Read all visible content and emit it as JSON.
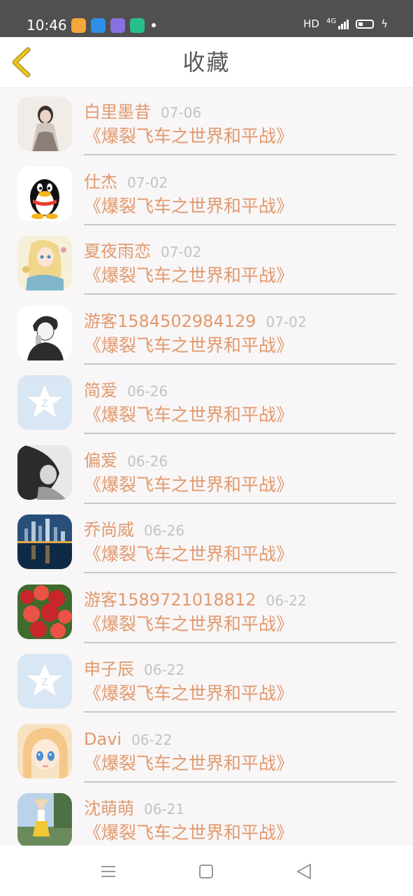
{
  "status_bar": {
    "time": "10:46",
    "network": "HD",
    "signal": "4G",
    "app_icons": [
      "calendar-app-icon",
      "browser-app-icon",
      "gallery-app-icon",
      "notes-app-icon"
    ],
    "app_colors": [
      "#f4a73a",
      "#2f8fe8",
      "#8a6fe0",
      "#27c08d"
    ]
  },
  "header": {
    "title": "收藏",
    "back_icon": "chevron-left-icon",
    "accent_color": "#f0c61e"
  },
  "favorites": [
    {
      "name": "白里墨昔",
      "date": "07-06",
      "book": "《爆裂飞车之世界和平战》",
      "avatar": "photo-woman-gray-dress",
      "avatar_colors": [
        "#d9d2cc",
        "#8b7f78",
        "#f1ece8"
      ]
    },
    {
      "name": "仕杰",
      "date": "07-02",
      "book": "《爆裂飞车之世界和平战》",
      "avatar": "qq-penguin",
      "avatar_colors": [
        "#ffffff",
        "#111111",
        "#e83b2a"
      ]
    },
    {
      "name": "夏夜雨恋",
      "date": "07-02",
      "book": "《爆裂飞车之世界和平战》",
      "avatar": "anime-girl-blonde",
      "avatar_colors": [
        "#f6e4a6",
        "#7fb6c9",
        "#e8c36e"
      ]
    },
    {
      "name": "游客1584502984129",
      "date": "07-02",
      "book": "《爆裂飞车之世界和平战》",
      "avatar": "sketch-boy",
      "avatar_colors": [
        "#ffffff",
        "#2c2c2c",
        "#bdbdbd"
      ]
    },
    {
      "name": "简爱",
      "date": "06-26",
      "book": "《爆裂飞车之世界和平战》",
      "avatar": "default-z-star",
      "avatar_colors": [
        "#d9e6f3",
        "#ffffff",
        "#c6d8ec"
      ]
    },
    {
      "name": "偏爱",
      "date": "06-26",
      "book": "《爆裂飞车之世界和平战》",
      "avatar": "photo-girl-bw",
      "avatar_colors": [
        "#e8e8e8",
        "#2b2b2b",
        "#9a9a9a"
      ]
    },
    {
      "name": "乔尚威",
      "date": "06-26",
      "book": "《爆裂飞车之世界和平战》",
      "avatar": "photo-city-skyline",
      "avatar_colors": [
        "#284f7a",
        "#e2a74c",
        "#0f2a44"
      ]
    },
    {
      "name": "游客1589721018812",
      "date": "06-22",
      "book": "《爆裂飞车之世界和平战》",
      "avatar": "photo-red-flowers",
      "avatar_colors": [
        "#c8262b",
        "#3f6b2c",
        "#e95346"
      ]
    },
    {
      "name": "申子辰",
      "date": "06-22",
      "book": "《爆裂飞车之世界和平战》",
      "avatar": "default-z-star",
      "avatar_colors": [
        "#d9e6f3",
        "#ffffff",
        "#c6d8ec"
      ]
    },
    {
      "name": "Davi",
      "date": "06-22",
      "book": "《爆裂飞车之世界和平战》",
      "avatar": "anime-girl-blue-eyes",
      "avatar_colors": [
        "#f7e3c2",
        "#4a8fd8",
        "#f5c88a"
      ]
    },
    {
      "name": "沈萌萌",
      "date": "06-21",
      "book": "《爆裂飞车之世界和平战》",
      "avatar": "photo-girl-outdoor",
      "avatar_colors": [
        "#b9d3e9",
        "#f1c935",
        "#6b8a5b"
      ]
    }
  ],
  "navigation_bar": {
    "buttons": [
      "menu-icon",
      "home-square-icon",
      "back-triangle-icon"
    ]
  }
}
